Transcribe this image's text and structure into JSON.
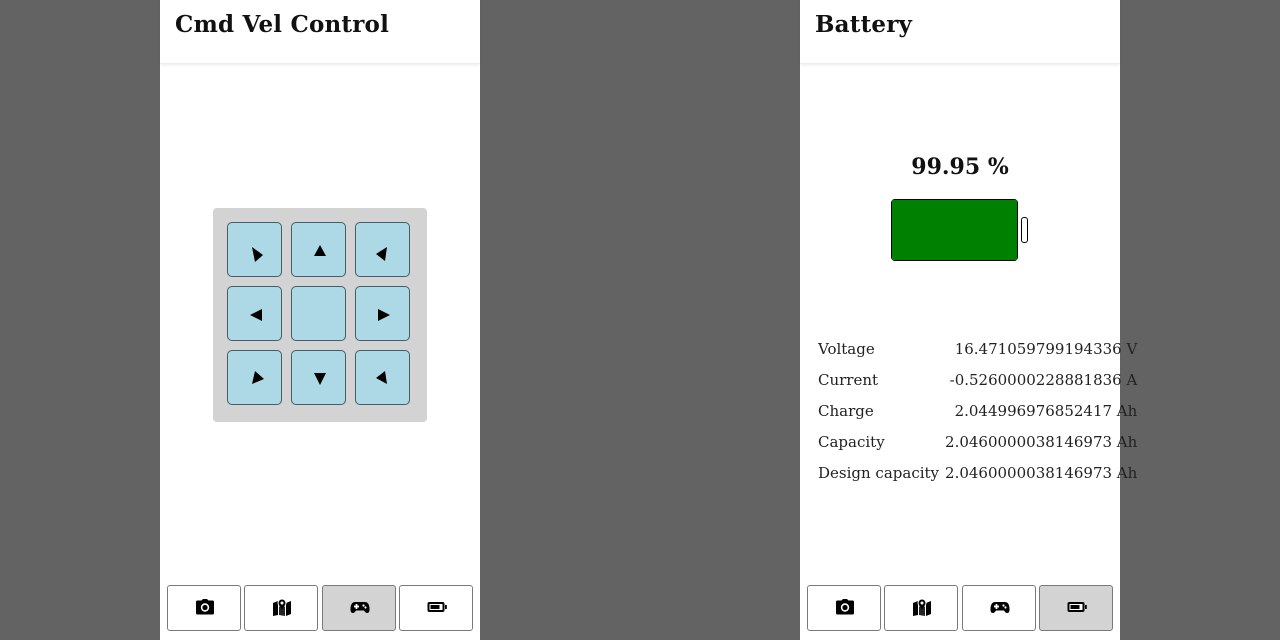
{
  "left_screen": {
    "title": "Cmd Vel Control",
    "dpad": {
      "buttons": [
        {
          "name": "forward-left",
          "icon": "arrow-up-left-icon"
        },
        {
          "name": "forward",
          "icon": "arrow-up-icon"
        },
        {
          "name": "forward-right",
          "icon": "arrow-up-right-icon"
        },
        {
          "name": "left",
          "icon": "arrow-left-icon"
        },
        {
          "name": "stop",
          "icon": ""
        },
        {
          "name": "right",
          "icon": "arrow-right-icon"
        },
        {
          "name": "backward-left",
          "icon": "arrow-down-left-icon"
        },
        {
          "name": "backward",
          "icon": "arrow-down-icon"
        },
        {
          "name": "backward-right",
          "icon": "arrow-down-right-icon"
        }
      ]
    },
    "nav": {
      "items": [
        {
          "name": "camera",
          "icon": "camera-icon",
          "active": false
        },
        {
          "name": "map",
          "icon": "map-icon",
          "active": false
        },
        {
          "name": "control",
          "icon": "gamepad-icon",
          "active": true
        },
        {
          "name": "battery",
          "icon": "battery-icon",
          "active": false
        }
      ]
    }
  },
  "right_screen": {
    "title": "Battery",
    "battery": {
      "percentage_text": "99.95 %",
      "level_percent": 99.95,
      "fill_color": "#008000"
    },
    "stats": [
      {
        "label": "Voltage",
        "value": "16.471059799194336 V"
      },
      {
        "label": "Current",
        "value": "-0.5260000228881836 A"
      },
      {
        "label": "Charge",
        "value": "2.044996976852417 Ah"
      },
      {
        "label": "Capacity",
        "value": "2.0460000038146973 Ah"
      },
      {
        "label": "Design capacity",
        "value": "2.0460000038146973 Ah"
      }
    ],
    "nav": {
      "items": [
        {
          "name": "camera",
          "icon": "camera-icon",
          "active": false
        },
        {
          "name": "map",
          "icon": "map-icon",
          "active": false
        },
        {
          "name": "control",
          "icon": "gamepad-icon",
          "active": false
        },
        {
          "name": "battery",
          "icon": "battery-icon",
          "active": true
        }
      ]
    }
  },
  "colors": {
    "background": "#636363",
    "dpad_button": "#add8e6",
    "dpad_panel": "#d3d3d3",
    "nav_active": "#d3d3d3"
  }
}
